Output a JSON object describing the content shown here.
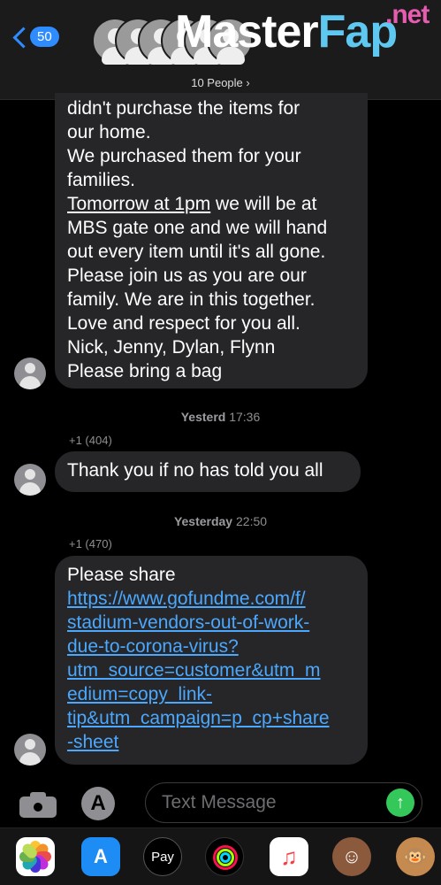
{
  "header": {
    "back_count": "50",
    "people_label": "10 People",
    "watermark": {
      "part_a": "Master",
      "part_b": "Fap",
      "part_c": ".net"
    }
  },
  "messages": [
    {
      "lines": [
        "didn't purchase the items for",
        "our home.",
        "We purchased them for your",
        "families."
      ],
      "underlined": "Tomorrow at 1pm",
      "after_underline": " we will be at",
      "rest": [
        "MBS gate one and we will hand",
        "out every item until it's all gone.",
        "Please join us as you are our",
        "family. We are in this together.",
        "Love and respect for you all.",
        "Nick, Jenny, Dylan, Flynn",
        "Please bring a bag"
      ]
    },
    {
      "timestamp_day": "Yesterd",
      "timestamp_time": "17:36",
      "sender": "+1 (404)",
      "text": "Thank you if no has told you all"
    },
    {
      "timestamp_day": "Yesterday",
      "timestamp_time": "22:50",
      "sender": "+1 (470)",
      "text": "Please share",
      "link_lines": [
        "https://www.gofundme.com/f/",
        "stadium-vendors-out-of-work-",
        "due-to-corona-virus?",
        "utm_source=customer&utm_m",
        "edium=copy_link-",
        "tip&utm_campaign=p_cp+share",
        "-sheet"
      ]
    }
  ],
  "input": {
    "placeholder": "Text Message"
  },
  "drawer": {
    "pay_label": "Pay"
  },
  "colors": {
    "accent": "#2f8cff",
    "bubble": "#262628",
    "link": "#4aa8ff",
    "send": "#34c759"
  }
}
